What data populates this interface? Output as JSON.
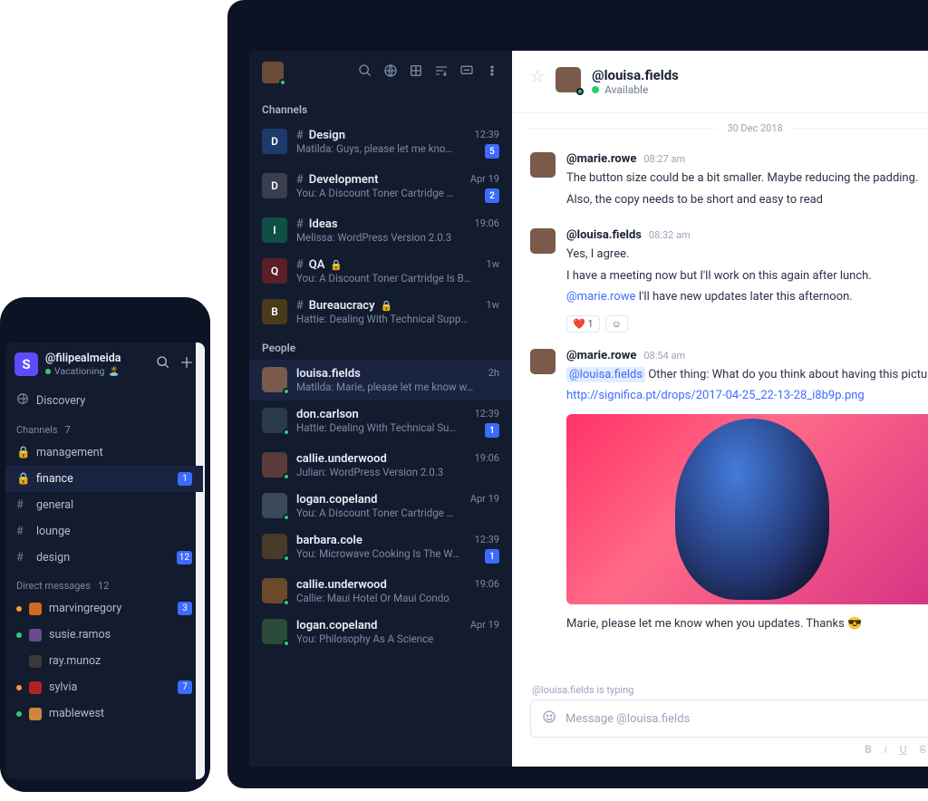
{
  "desktop": {
    "sections": {
      "channels": "Channels",
      "people": "People"
    },
    "channels": [
      {
        "letter": "D",
        "color": "#1e3a6b",
        "name": "Design",
        "preview": "Matilda: Guys, please let me know wh...",
        "time": "12:39",
        "badge": "5"
      },
      {
        "letter": "D",
        "color": "#3a3f4f",
        "name": "Development",
        "preview": "You: A Discount Toner Cartridge Is B...",
        "time": "Apr 19",
        "badge": "2"
      },
      {
        "letter": "I",
        "color": "#0f4f45",
        "name": "Ideas",
        "preview": "Melissa: WordPress Version 2.0.3",
        "time": "19:06",
        "badge": ""
      },
      {
        "letter": "Q",
        "color": "#5a1f28",
        "name": "QA",
        "locked": true,
        "preview": "You: A Discount Toner Cartridge Is B...",
        "time": "1w",
        "badge": ""
      },
      {
        "letter": "B",
        "color": "#4a3b18",
        "name": "Bureaucracy",
        "locked": true,
        "preview": "Hattie: Dealing With Technical Suppo..",
        "time": "1w",
        "badge": ""
      }
    ],
    "people": [
      {
        "name": "louisa.fields",
        "preview": "Matilda: Marie, please let me know w...",
        "time": "2h",
        "badge": "",
        "selected": true,
        "av": "#7a5a4a"
      },
      {
        "name": "don.carlson",
        "preview": "Hattie: Dealing With Technical Support",
        "time": "12:39",
        "badge": "1",
        "av": "#2a3a4a"
      },
      {
        "name": "callie.underwood",
        "preview": "Julian: WordPress Version 2.0.3",
        "time": "19:06",
        "badge": "",
        "av": "#5a3a3a"
      },
      {
        "name": "logan.copeland",
        "preview": "You: A Discount Toner Cartridge Is B...",
        "time": "Apr 19",
        "badge": "",
        "av": "#3a4a5a"
      },
      {
        "name": "barbara.cole",
        "preview": "You: Microwave Cooking Is The Wav...",
        "time": "12:39",
        "badge": "1",
        "av": "#4a3a2a"
      },
      {
        "name": "callie.underwood",
        "preview": "Callie: Maui Hotel Or Maui Condo",
        "time": "19:06",
        "badge": "",
        "av": "#6a4a2a"
      },
      {
        "name": "logan.copeland",
        "preview": "You: Philosophy As A Science",
        "time": "Apr 19",
        "badge": "",
        "av": "#2a4a3a"
      }
    ]
  },
  "chat": {
    "title": "@louisa.fields",
    "status": "Available",
    "date": "30 Dec 2018",
    "messages": [
      {
        "user": "@marie.rowe",
        "time": "08:27 am",
        "lines": [
          "The button size could be a bit smaller. Maybe reducing the padding.",
          "Also, the copy needs to be short and easy to read"
        ]
      },
      {
        "user": "@louisa.fields",
        "time": "08:32 am",
        "lines": [
          "Yes, I agree.",
          "I have a meeting now but I'll work on this again after lunch."
        ],
        "mention_line": {
          "mention": "@marie.rowe",
          "rest": " I'll have new updates later this afternoon."
        },
        "reaction": {
          "emoji": "❤️",
          "count": "1"
        }
      },
      {
        "user": "@marie.rowe",
        "time": "08:54 am",
        "hl_mention_line": {
          "mention": "@louisa.fields",
          "rest": " Other thing: What do you think about having this picture in t"
        },
        "link": "http://significa.pt/drops/2017-04-25_22-13-28_i8b9p.png",
        "has_image": true,
        "trailer": "Marie, please let me know when you updates. Thanks 😎"
      }
    ],
    "typing": "@louisa.fields is typing",
    "placeholder": "Message @louisa.fields"
  },
  "phone": {
    "logo": "S",
    "user": "@filipealmeida",
    "status": "Vacationing",
    "status_emoji": "🏝️",
    "discovery": "Discovery",
    "sections": {
      "channels": "Channels",
      "channels_count": "7",
      "dms": "Direct messages",
      "dms_count": "12"
    },
    "channels": [
      {
        "icon": "lock",
        "name": "management",
        "badge": ""
      },
      {
        "icon": "lock",
        "name": "finance",
        "badge": "1",
        "active": true
      },
      {
        "icon": "hash",
        "name": "general",
        "badge": ""
      },
      {
        "icon": "hash",
        "name": "lounge",
        "badge": ""
      },
      {
        "icon": "hash",
        "name": "design",
        "badge": "12"
      }
    ],
    "dms": [
      {
        "name": "marvingregory",
        "badge": "3",
        "color": "#d2691e",
        "dot": "#ff9933"
      },
      {
        "name": "susie.ramos",
        "badge": "",
        "color": "#6a4a8a",
        "dot": "#2ecc71"
      },
      {
        "name": "ray.munoz",
        "badge": "",
        "color": "#3a3a3a",
        "dot": ""
      },
      {
        "name": "sylvia",
        "badge": "7",
        "color": "#b22222",
        "dot": "#ff9933"
      },
      {
        "name": "mablewest",
        "badge": "",
        "color": "#cd853f",
        "dot": "#2ecc71"
      }
    ]
  }
}
